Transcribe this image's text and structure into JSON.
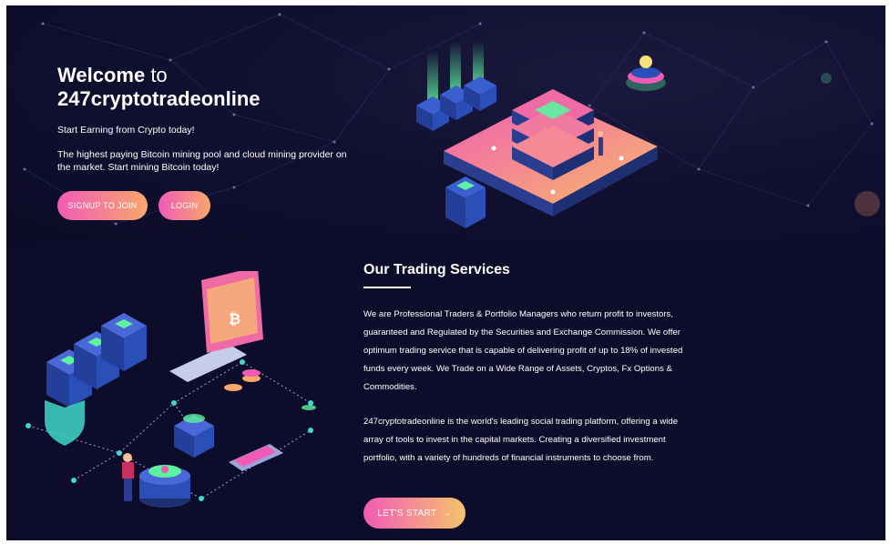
{
  "hero": {
    "welcome_bold": "Welcome",
    "welcome_light": "to",
    "site_name": "247cryptotradeonline",
    "tagline": "Start Earning from Crypto today!",
    "description": "The highest paying Bitcoin mining pool and cloud mining provider on the market. Start mining Bitcoin today!",
    "signup_label": "SIGNUP TO JOIN",
    "login_label": "LOGIN"
  },
  "services": {
    "title": "Our Trading Services",
    "paragraph1": "We are Professional Traders & Portfolio Managers who return profit to investors, guaranteed and Regulated by the Securities and Exchange Commission. We offer optimum trading service that is capable of delivering profit of up to 18% of invested funds every week. We Trade on a Wide Range of Assets, Cryptos, Fx Options & Commodities.",
    "paragraph2": "247cryptotradeonline is the world's leading social trading platform, offering a wide array of tools to invest in the capital markets. Creating a diversified investment portfolio, with a variety of hundreds of financial instruments to choose from.",
    "start_label": "LET'S START",
    "start_arrow": "→"
  },
  "icons": {
    "arrow": "arrow-right-icon",
    "mining": "mining-platform-illustration",
    "network": "crypto-network-illustration"
  },
  "colors": {
    "background": "#0d0c2a",
    "button_gradient_start": "#f15bb5",
    "button_gradient_end": "#f7a76c",
    "accent_green": "#5cf2a0"
  }
}
